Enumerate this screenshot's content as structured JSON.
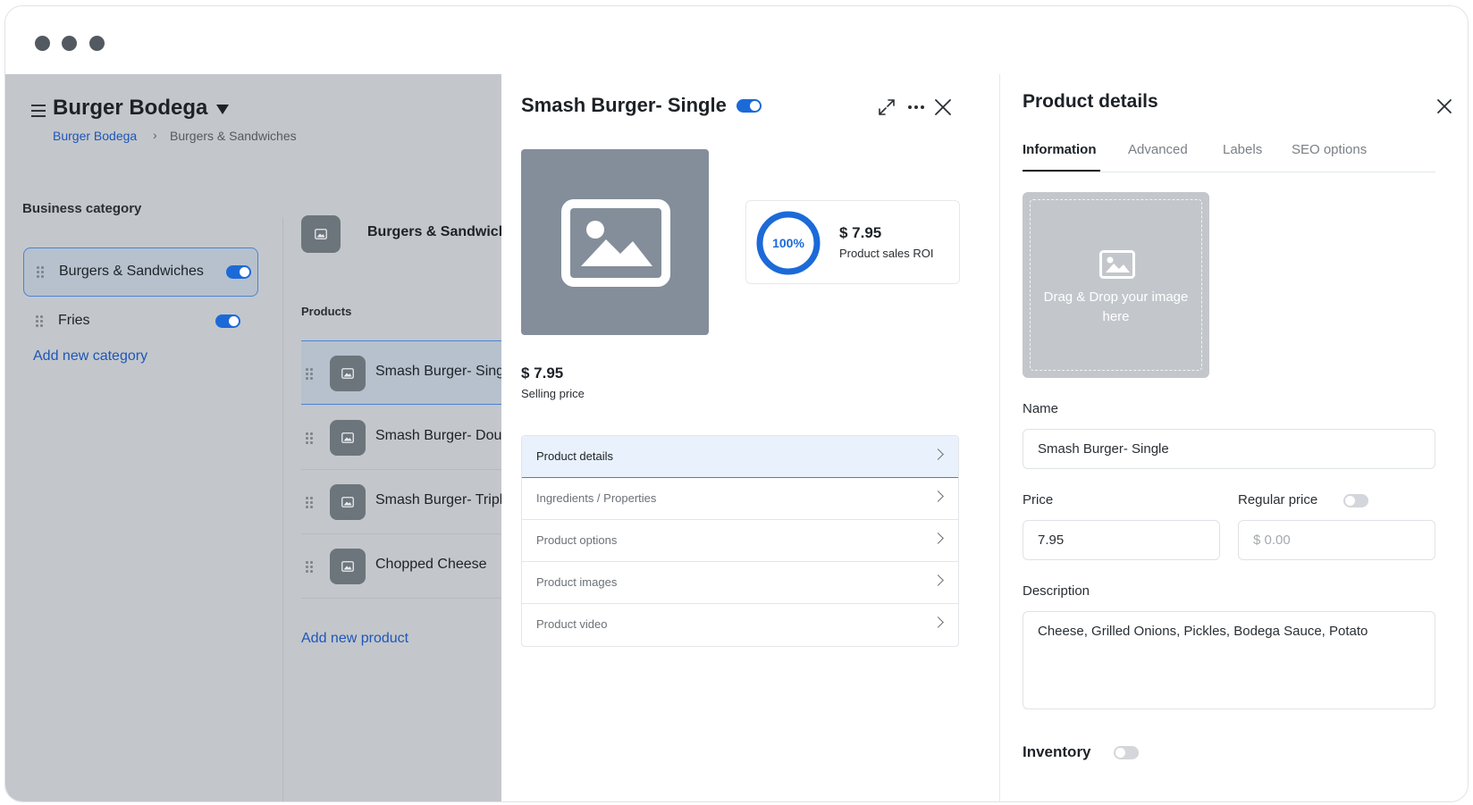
{
  "window": {
    "dot_color": "#535960"
  },
  "sidebar": {
    "business_name": "Burger Bodega",
    "breadcrumb": [
      "Burger Bodega",
      "Burgers & Sandwiches"
    ],
    "category_heading": "Business category",
    "categories": [
      {
        "label": "Burgers & Sandwiches",
        "enabled": true,
        "active": true
      },
      {
        "label": "Fries",
        "enabled": true,
        "active": false
      }
    ],
    "add_category": "Add new category"
  },
  "category_panel": {
    "title": "Burgers & Sandwiches",
    "products_heading": "Products",
    "products": [
      {
        "name": "Smash Burger- Single",
        "active": true
      },
      {
        "name": "Smash Burger- Double",
        "active": false
      },
      {
        "name": "Smash Burger- Triple",
        "active": false
      },
      {
        "name": "Chopped Cheese",
        "active": false
      }
    ],
    "add_product": "Add new product"
  },
  "product_panel": {
    "title": "Smash Burger- Single",
    "enabled": true,
    "roi_percent": "100%",
    "roi_fraction": 1.0,
    "roi_value": "$ 7.95",
    "roi_label": "Product sales ROI",
    "selling_price": "$ 7.95",
    "selling_price_label": "Selling price",
    "menu": [
      {
        "label": "Product details",
        "active": true
      },
      {
        "label": "Ingredients / Properties",
        "active": false
      },
      {
        "label": "Product options",
        "active": false
      },
      {
        "label": "Product images",
        "active": false
      },
      {
        "label": "Product video",
        "active": false
      }
    ]
  },
  "details_panel": {
    "title": "Product details",
    "tabs": [
      "Information",
      "Advanced",
      "Labels",
      "SEO options"
    ],
    "active_tab": "Information",
    "dropzone_text": "Drag & Drop your image here",
    "name_label": "Name",
    "name_value": "Smash Burger- Single",
    "price_label": "Price",
    "price_value": "7.95",
    "regular_price_label": "Regular price",
    "regular_price_enabled": false,
    "regular_price_placeholder": "$ 0.00",
    "description_label": "Description",
    "description_value": "Cheese, Grilled Onions, Pickles, Bodega Sauce, Potato",
    "inventory_label": "Inventory",
    "inventory_enabled": false
  },
  "colors": {
    "accent": "#1c6ad8",
    "link": "#1f55b9",
    "overlay": "#c3c7cb",
    "active_row": "#b6c1cd"
  }
}
